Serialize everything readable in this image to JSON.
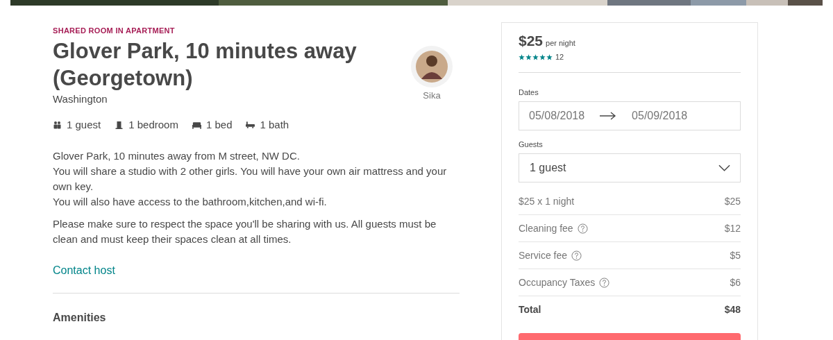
{
  "listing": {
    "room_type": "SHARED ROOM IN APARTMENT",
    "title": "Glover Park, 10 minutes away (Georgetown)",
    "city": "Washington",
    "host": {
      "name": "Sika"
    },
    "facts": [
      {
        "kind": "guests",
        "label": "1 guest"
      },
      {
        "kind": "bedroom",
        "label": "1 bedroom"
      },
      {
        "kind": "bed",
        "label": "1 bed"
      },
      {
        "kind": "bath",
        "label": "1 bath"
      }
    ],
    "description": [
      "Glover Park, 10 minutes away from M street, NW DC.\nYou will share a studio with 2 other girls. You will have your own air mattress and your own key.\nYou will also have access to the bathroom,kitchen,and wi-fi.",
      "Please make sure to respect the space you'll be sharing with us. All guests must be clean and must keep their spaces clean at all times."
    ],
    "contact_link": "Contact host",
    "section_heading": "Amenities"
  },
  "booking": {
    "price": "$25",
    "price_unit": "per night",
    "stars": 5,
    "review_count": "12",
    "dates_label": "Dates",
    "check_in": "05/08/2018",
    "check_out": "05/09/2018",
    "guests_label": "Guests",
    "guests_value": "1 guest",
    "fees": [
      {
        "label": "$25 x 1 night",
        "amount": "$25",
        "help": false,
        "kind": "line"
      },
      {
        "label": "Cleaning fee",
        "amount": "$12",
        "help": true,
        "kind": "line"
      },
      {
        "label": "Service fee",
        "amount": "$5",
        "help": true,
        "kind": "line"
      },
      {
        "label": "Occupancy Taxes",
        "amount": "$6",
        "help": true,
        "kind": "line"
      },
      {
        "label": "Total",
        "amount": "$48",
        "help": false,
        "kind": "total"
      }
    ]
  }
}
